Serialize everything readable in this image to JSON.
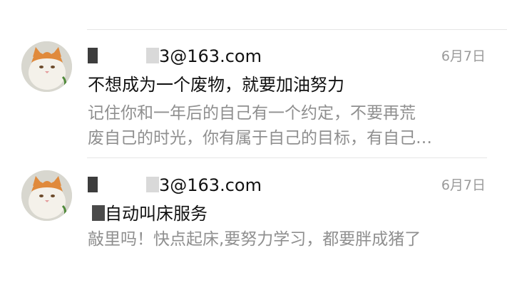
{
  "mail_list": {
    "items": [
      {
        "sender_visible": "3@163.com",
        "date": "6月7日",
        "subject": "不想成为一个废物，就要加油努力",
        "preview_line1": "记住你和一年后的自己有一个约定，不要再荒",
        "preview_line2": "废自己的时光，你有属于自己的目标，有自己…",
        "avatar_icon": "cat-avatar-icon"
      },
      {
        "sender_visible": "3@163.com",
        "date": "6月7日",
        "subject": "自动叫床服务",
        "preview_line1": "敲里吗！快点起床,要努力学习，都要胖成猪了",
        "avatar_icon": "cat-avatar-icon"
      }
    ]
  }
}
